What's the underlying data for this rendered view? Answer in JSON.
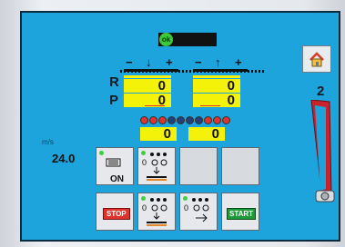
{
  "status": {
    "indicator_label": "ok"
  },
  "nav": {
    "page_number": "2",
    "home_icon": "home-icon"
  },
  "groups": [
    {
      "minus": "−",
      "direction": "↓",
      "plus": "+"
    },
    {
      "minus": "−",
      "direction": "↑",
      "plus": "+"
    }
  ],
  "rows": [
    {
      "label": "R",
      "left_value": "0",
      "right_value": "0"
    },
    {
      "label": "P",
      "left_value": "0",
      "right_value": "0"
    }
  ],
  "lower_values": {
    "left": "0",
    "right": "0"
  },
  "speed": {
    "unit": "m/s",
    "value": "24.0"
  },
  "buttons": {
    "on_label": "ON",
    "stop_label": "STOP",
    "start_label": "START"
  },
  "colors": {
    "screen": "#1da4dc",
    "value_box": "#f5f20a",
    "led": "#3bd33b",
    "belt": "#c8232c"
  }
}
